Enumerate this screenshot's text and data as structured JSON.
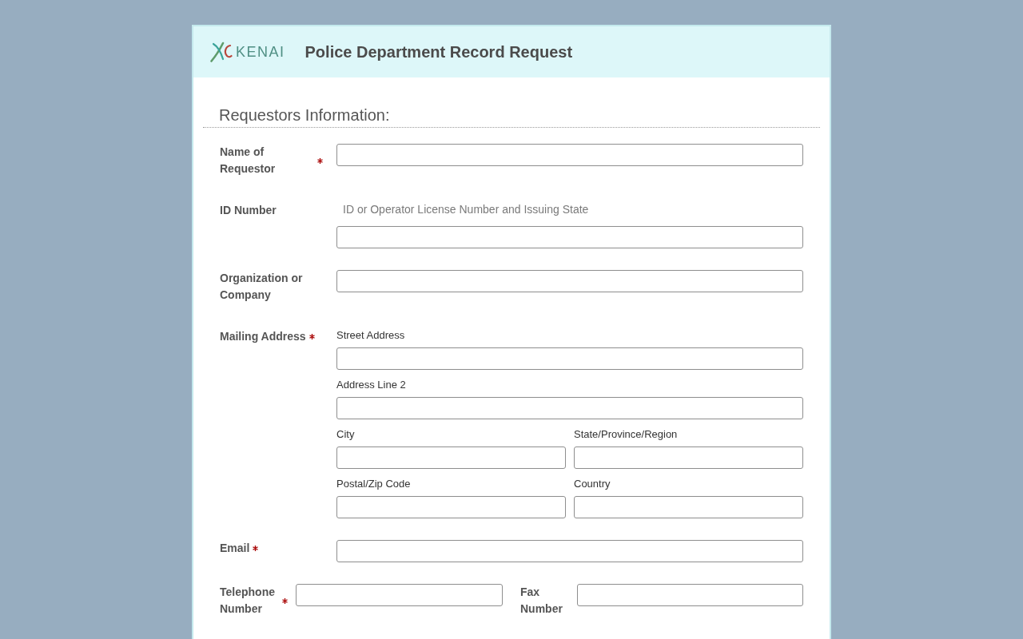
{
  "header": {
    "logo_text": "KENAI",
    "title": "Police Department Record Request"
  },
  "section_title": "Requestors Information:",
  "fields": [
    {
      "kind": "text",
      "label": "Name of Requestor",
      "required": true
    },
    {
      "kind": "text",
      "label": "ID Number",
      "required": false,
      "note": "ID or Operator License Number and Issuing State"
    },
    {
      "kind": "text",
      "label": "Organization or Company",
      "required": false
    },
    {
      "kind": "address",
      "label": "Mailing Address",
      "required": true,
      "rows": [
        {
          "parts": [
            {
              "label": "Street Address"
            }
          ]
        },
        {
          "parts": [
            {
              "label": "Address Line 2"
            }
          ]
        },
        {
          "parts": [
            {
              "label": "City"
            },
            {
              "label": "State/Province/Region"
            }
          ]
        },
        {
          "parts": [
            {
              "label": "Postal/Zip Code"
            },
            {
              "label": "Country"
            }
          ]
        }
      ]
    },
    {
      "kind": "text",
      "label": "Email",
      "required": true
    },
    {
      "kind": "pair",
      "items": [
        {
          "label": "Telephone Number",
          "required": true
        },
        {
          "label": "Fax Number",
          "required": false
        }
      ]
    }
  ]
}
